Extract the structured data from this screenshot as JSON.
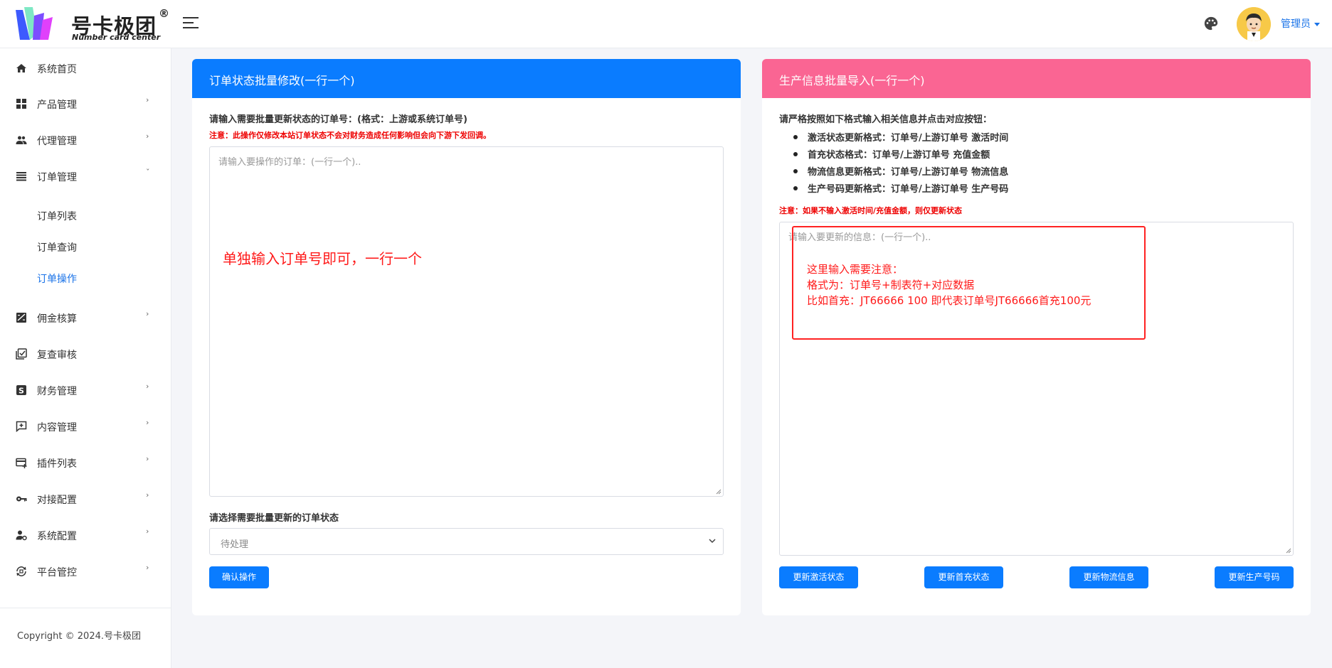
{
  "brand": {
    "name": "号卡极团",
    "registered": "®",
    "subtitle": "Number card center"
  },
  "header": {
    "user_label": "管理员"
  },
  "sidebar": {
    "items": [
      {
        "label": "系统首页",
        "icon": "home-icon"
      },
      {
        "label": "产品管理",
        "icon": "grid-icon",
        "chevron": "›"
      },
      {
        "label": "代理管理",
        "icon": "people-icon",
        "chevron": "›"
      },
      {
        "label": "订单管理",
        "icon": "list-icon",
        "chevron": "ˇ"
      },
      {
        "label": "佣金核算",
        "icon": "chart-icon",
        "chevron": "›"
      },
      {
        "label": "复查审核",
        "icon": "review-icon"
      },
      {
        "label": "财务管理",
        "icon": "dollar-icon",
        "chevron": "›"
      },
      {
        "label": "内容管理",
        "icon": "comment-icon",
        "chevron": "›"
      },
      {
        "label": "插件列表",
        "icon": "card-icon",
        "chevron": "›"
      },
      {
        "label": "对接配置",
        "icon": "key-icon",
        "chevron": "›"
      },
      {
        "label": "系统配置",
        "icon": "user-gear-icon",
        "chevron": "›"
      },
      {
        "label": "平台管控",
        "icon": "sync-icon",
        "chevron": "›"
      }
    ],
    "sub_items": [
      {
        "label": "订单列表"
      },
      {
        "label": "订单查询"
      },
      {
        "label": "订单操作"
      }
    ],
    "copyright": "Copyright © 2024.号卡极团"
  },
  "left_card": {
    "title": "订单状态批量修改(一行一个)",
    "input_label": "请输入需要批量更新状态的订单号：(格式：上游或系统订单号)",
    "warning": "注意：此操作仅修改本站订单状态不会对财务造成任何影响但会向下游下发回调。",
    "textarea_placeholder": "请输入要操作的订单：(一行一个)..",
    "annotation": "单独输入订单号即可，一行一个",
    "select_label": "请选择需要批量更新的订单状态",
    "select_value": "待处理",
    "confirm_button": "确认操作"
  },
  "right_card": {
    "title": "生产信息批量导入(一行一个)",
    "instruction": "请严格按照如下格式输入相关信息并点击对应按钮：",
    "formats": [
      "激活状态更新格式：订单号/上游订单号 激活时间",
      "首充状态格式：订单号/上游订单号 充值金额",
      "物流信息更新格式：订单号/上游订单号 物流信息",
      "生产号码更新格式：订单号/上游订单号 生产号码"
    ],
    "warning": "注意：如果不输入激活时间/充值金额，则仅更新状态",
    "textarea_placeholder": "请输入要更新的信息：(一行一个)..",
    "annotation_lines": [
      "这里输入需要注意：",
      "格式为：订单号+制表符+对应数据",
      "比如首充：JT66666  100 即代表订单号JT66666首充100元"
    ],
    "buttons": [
      "更新激活状态",
      "更新首充状态",
      "更新物流信息",
      "更新生产号码"
    ]
  },
  "colors": {
    "primary": "#0a7cff",
    "pink_header": "#fa6593",
    "warning_red": "#ff1a1a",
    "active_link": "#1a73e8"
  }
}
